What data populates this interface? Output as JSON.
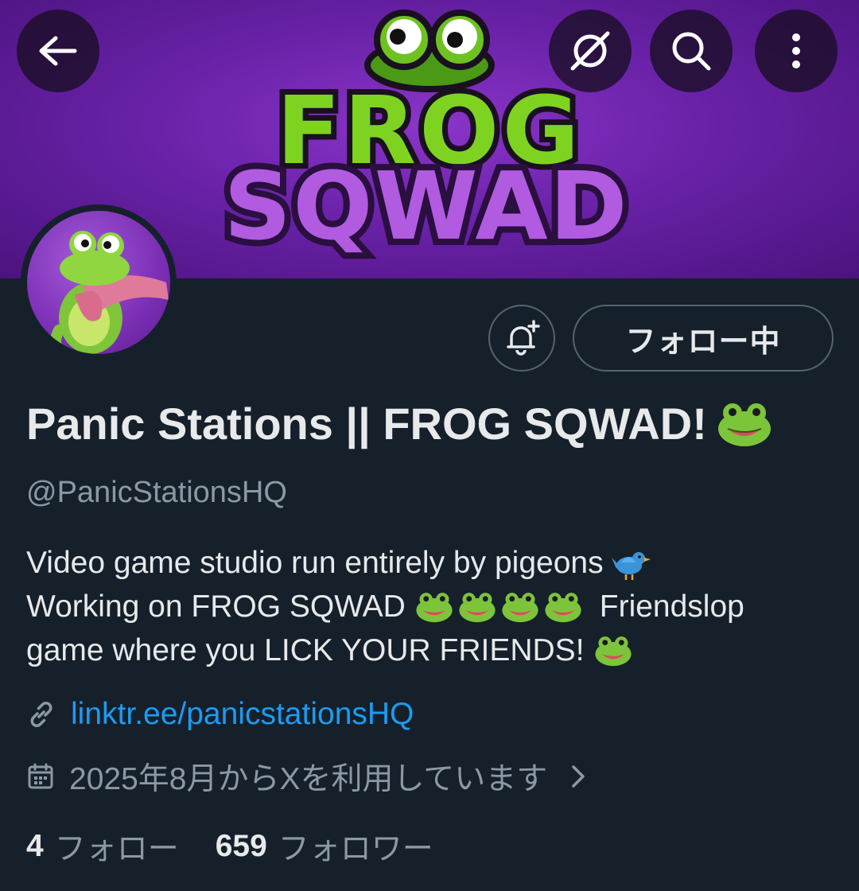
{
  "header": {
    "back_icon": "arrow-left-icon",
    "grok_icon": "grok-icon",
    "search_icon": "search-icon",
    "more_icon": "more-vertical-icon"
  },
  "banner": {
    "logo_line1": "FROG",
    "logo_line2": "SQWAD"
  },
  "actions": {
    "notify_icon": "bell-plus-icon",
    "follow_label": "フォロー中"
  },
  "profile": {
    "display_name": "Panic Stations || FROG SQWAD!",
    "display_name_emoji": "frog-emoji",
    "handle": "@PanicStationsHQ",
    "bio": {
      "line1": "Video game studio run entirely by pigeons",
      "line1_emoji": "bird-emoji",
      "line2_a": "Working on FROG SQWAD",
      "line2_b": "Friendslop",
      "line3": "game where you LICK YOUR FRIENDS!"
    },
    "link_text": "linktr.ee/panicstationsHQ",
    "joined_text": "2025年8月からXを利用しています"
  },
  "stats": {
    "following_count": "4",
    "following_label": "フォロー",
    "followers_count": "659",
    "followers_label": "フォロワー"
  },
  "colors": {
    "background": "#15202b",
    "text_primary": "#e7e9ea",
    "text_secondary": "#8b98a5",
    "link": "#1d9bf0",
    "border": "#536471",
    "banner_purple": "#6a22a8",
    "frog_green": "#7ed321"
  }
}
